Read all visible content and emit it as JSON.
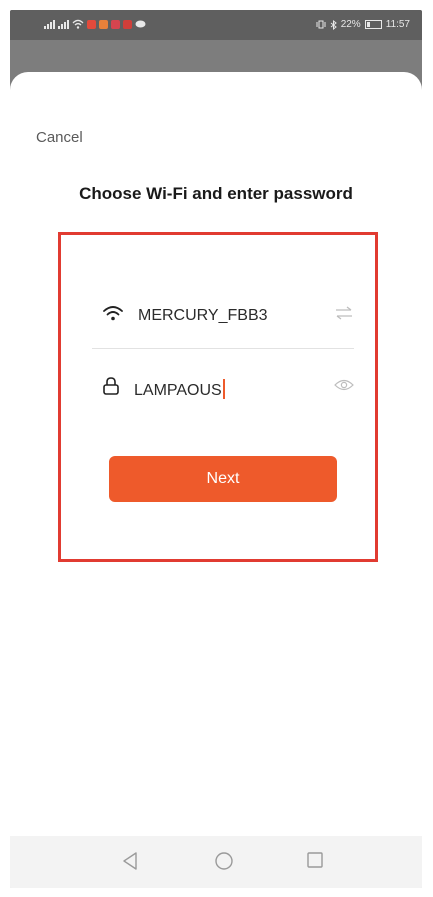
{
  "status_bar": {
    "left_icons": [
      "signal-icon",
      "signal-icon",
      "wifi-icon",
      "app-notification-icon",
      "app-notification-icon",
      "app-notification-icon",
      "app-notification-icon",
      "message-icon"
    ],
    "battery": "22%",
    "time": "11:57"
  },
  "header": {
    "cancel_label": "Cancel"
  },
  "main": {
    "title": "Choose Wi-Fi and enter password",
    "wifi": {
      "ssid": "MERCURY_FBB3",
      "icon": "wifi-icon",
      "action_icon": "switch-network-icon"
    },
    "password": {
      "value": "LAMPAOUS",
      "icon": "lock-icon",
      "action_icon": "eye-icon"
    },
    "next_label": "Next"
  },
  "colors": {
    "accent": "#ee5a2b",
    "highlight_border": "#e13b31"
  },
  "nav": {
    "buttons": [
      "back-icon",
      "home-icon",
      "recents-icon"
    ]
  }
}
